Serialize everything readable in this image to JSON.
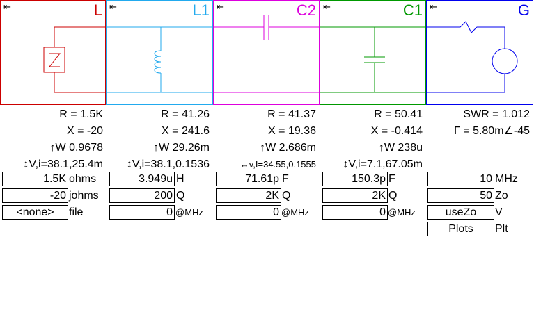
{
  "colors": {
    "L": "#cc0000",
    "L1": "#22aaee",
    "C2": "#dd00dd",
    "C1": "#009900",
    "G": "#0000ee"
  },
  "panels": {
    "L": {
      "arrow": "⇤",
      "title": "L"
    },
    "L1": {
      "arrow": "⇤",
      "title": "L1"
    },
    "C2": {
      "arrow": "⇤",
      "title": "C2"
    },
    "C1": {
      "arrow": "⇤",
      "title": "C1"
    },
    "G": {
      "arrow": "⇤",
      "title": "G"
    }
  },
  "readouts": {
    "L": {
      "r": "R = 1.5K",
      "x": "X = -20",
      "w": "↑W 0.9678",
      "vi": "↕V,i=38.1,25.4m"
    },
    "L1": {
      "r": "R = 41.26",
      "x": "X = 241.6",
      "w": "↑W 29.26m",
      "vi": "↕V,i=38.1,0.1536"
    },
    "C2": {
      "r": "R = 41.37",
      "x": "X = 19.36",
      "w": "↑W 2.686m",
      "vi": "↔v,I=34.55,0.1555"
    },
    "C1": {
      "r": "R = 50.41",
      "x": "X = -0.414",
      "w": "↑W 238u",
      "vi": "↕V,i=7.1,67.05m"
    },
    "G": {
      "swr": "SWR = 1.012",
      "gamma": "Γ = 5.80m∠-45"
    }
  },
  "fields": {
    "L": [
      {
        "value": "1.5K",
        "unit": "ohms"
      },
      {
        "value": "-20",
        "unit": "johms"
      },
      {
        "value": "<none>",
        "unit": "file"
      }
    ],
    "L1": [
      {
        "value": "3.949u",
        "unit": "H"
      },
      {
        "value": "200",
        "unit": "Q"
      },
      {
        "value": "0",
        "unit": "@MHz"
      }
    ],
    "C2": [
      {
        "value": "71.61p",
        "unit": "F"
      },
      {
        "value": "2K",
        "unit": "Q"
      },
      {
        "value": "0",
        "unit": "@MHz"
      }
    ],
    "C1": [
      {
        "value": "150.3p",
        "unit": "F"
      },
      {
        "value": "2K",
        "unit": "Q"
      },
      {
        "value": "0",
        "unit": "@MHz"
      }
    ],
    "G": [
      {
        "value": "10",
        "unit": "MHz"
      },
      {
        "value": "50",
        "unit": "Zo"
      },
      {
        "value": "useZo",
        "unit": "V"
      },
      {
        "value": "Plots",
        "unit": "Plt"
      }
    ]
  }
}
